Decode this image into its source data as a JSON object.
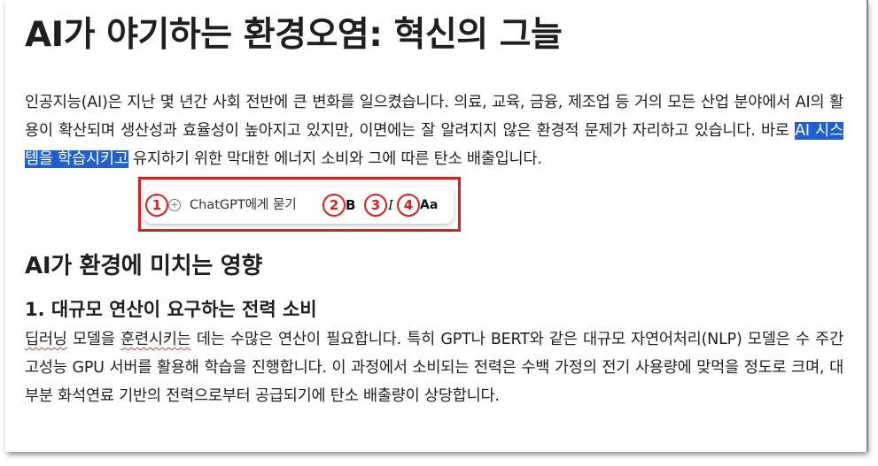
{
  "document": {
    "title": "AI가 야기하는 환경오염: 혁신의 그늘",
    "intro_part1": "인공지능(AI)은 지난 몇 년간 사회 전반에 큰 변화를 일으켰습니다. 의료, 교육, 금융, 제조업 등 거의 모든 산업 분야에서 AI의 활용이 확산되며 생산성과 효율성이 높아지고 있지만, 이면에는 잘 알려지지 않은 환경적 문제가 자리하고 있습니다. 바로 ",
    "intro_selected": "AI 시스템을 학습시키고",
    "intro_part2": " 유지하기 위한 막대한 에너지 소비와 그에 따른 탄소 배출입니다.",
    "section_heading": "AI가 환경에 미치는 영향",
    "subsection_heading": "1. 대규모 연산이 요구하는 전력 소비",
    "body_word1": "딥러닝",
    "body_mid1": " 모델을 ",
    "body_word2": "훈련시키는",
    "body_rest": " 데는 수많은 연산이 필요합니다. 특히 GPT나 BERT와 같은 대규모 자연어처리(NLP) 모델은 수 주간 고성능 GPU 서버를 활용해 학습을 진행합니다. 이 과정에서 소비되는 전력은 수백 가정의 전기 사용량에 맞먹을 정도로 크며, 대부분 화석연료 기반의 전력으로부터 공급되기에 탄소 배출량이 상당합니다."
  },
  "toolbar": {
    "ask_label": "ChatGPT에게 묻기",
    "bold_label": "B",
    "italic_label": "I",
    "text_style_label": "Aa",
    "badges": [
      "1",
      "2",
      "3",
      "4"
    ]
  },
  "colors": {
    "selection": "#1f5fcf",
    "annotation_red": "#e01e1e"
  }
}
